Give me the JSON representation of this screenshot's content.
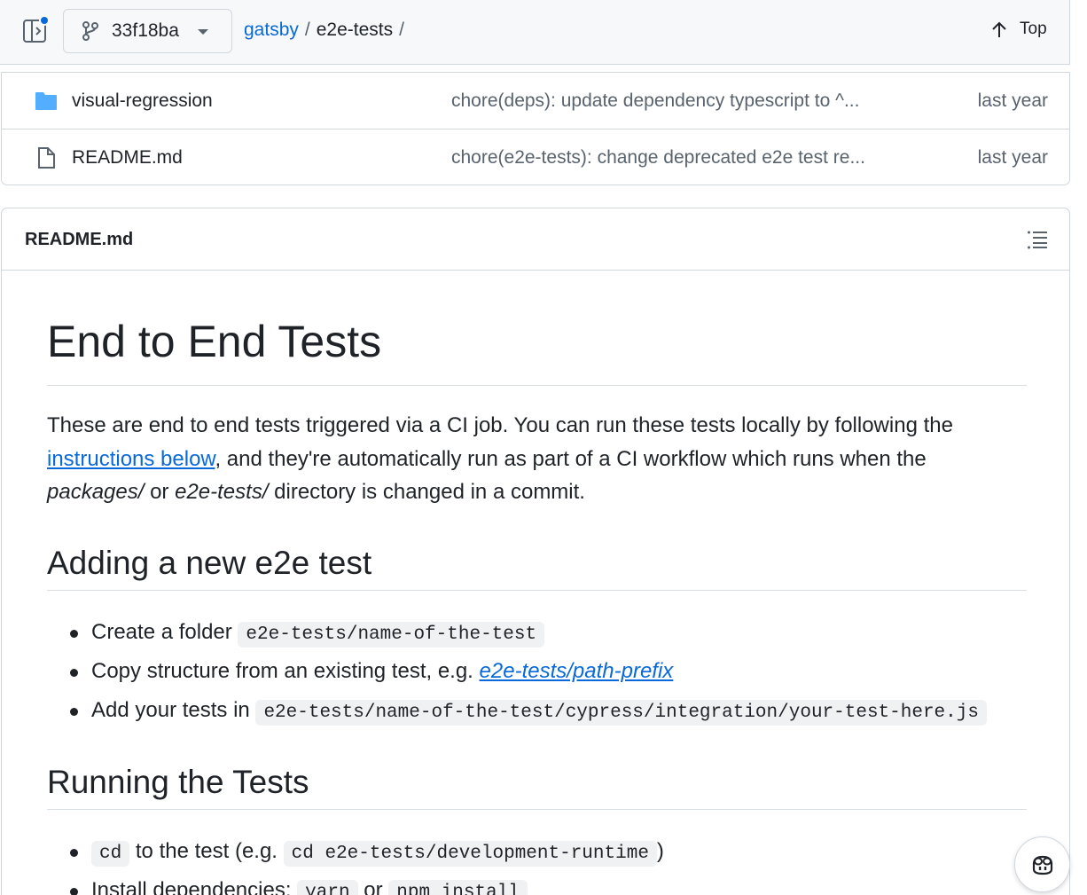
{
  "header": {
    "branch": "33f18ba",
    "breadcrumb": {
      "repo": "gatsby",
      "sep1": "/",
      "folder": "e2e-tests",
      "sep2": "/"
    },
    "top_label": "Top"
  },
  "files": [
    {
      "type": "folder",
      "name": "visual-regression",
      "commit": "chore(deps): update dependency typescript to ^...",
      "age": "last year"
    },
    {
      "type": "file",
      "name": "README.md",
      "commit": "chore(e2e-tests): change deprecated e2e test re...",
      "age": "last year"
    }
  ],
  "readme": {
    "filename": "README.md",
    "h1": "End to End Tests",
    "intro": {
      "p1": "These are end to end tests triggered via a CI job. You can run these tests locally by following the ",
      "link": "instructions below",
      "p2": ", and they're automatically run as part of a CI workflow which runs when the ",
      "em1": "packages/",
      "p3": " or ",
      "em2": "e2e-tests/",
      "p4": " directory is changed in a commit."
    },
    "section1": {
      "title": "Adding a new e2e test",
      "item1_text": "Create a folder ",
      "item1_code": "e2e-tests/name-of-the-test",
      "item2_text": "Copy structure from an existing test, e.g. ",
      "item2_link": "e2e-tests/path-prefix",
      "item3_text": "Add your tests in ",
      "item3_code": "e2e-tests/name-of-the-test/cypress/integration/your-test-here.js"
    },
    "section2": {
      "title": "Running the Tests",
      "item1_code": "cd",
      "item1_text": " to the test (e.g. ",
      "item1_code2": "cd e2e-tests/development-runtime",
      "item1_end": ")",
      "item2_text": "Install dependencies: ",
      "item2_code": "yarn",
      "item2_mid": " or ",
      "item2_code2": "npm install"
    }
  },
  "colors": {
    "link": "#0969da",
    "muted": "#59636e",
    "folder": "#54aeff",
    "border": "#d0d7de"
  },
  "icons": [
    "sidebar-toggle-icon",
    "git-branch-icon",
    "chevron-down-icon",
    "arrow-up-icon",
    "folder-icon",
    "file-icon",
    "list-outline-icon",
    "copilot-icon"
  ]
}
